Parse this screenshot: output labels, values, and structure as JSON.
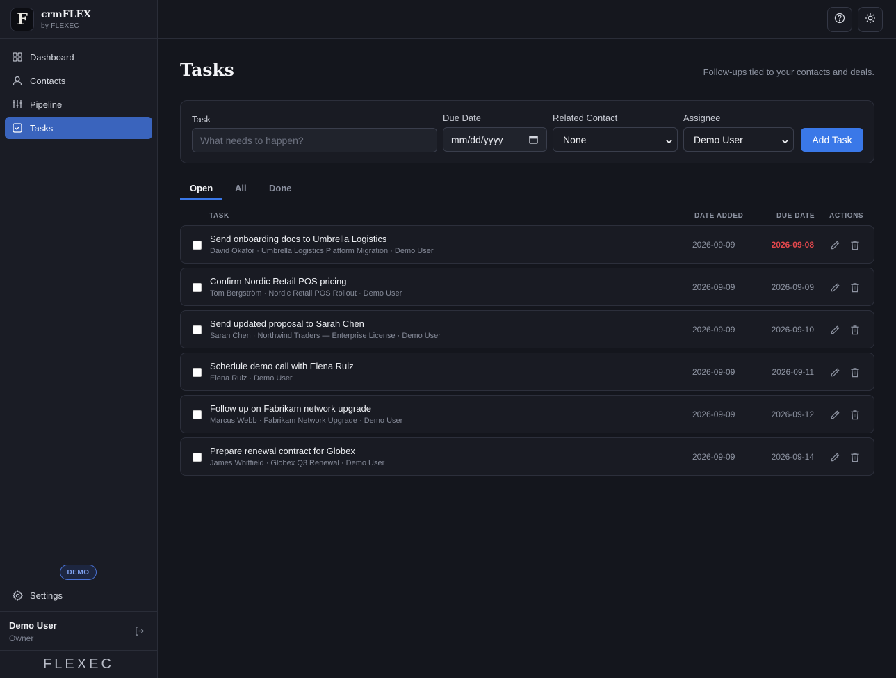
{
  "brand": {
    "logo_glyph": "F",
    "name": "crmFLEX",
    "sub": "by FLEXEC"
  },
  "nav": [
    {
      "label": "Dashboard",
      "icon": "grid-icon"
    },
    {
      "label": "Contacts",
      "icon": "user-icon"
    },
    {
      "label": "Pipeline",
      "icon": "sliders-icon"
    },
    {
      "label": "Tasks",
      "icon": "check-square-icon",
      "active": true
    }
  ],
  "sidebar_footer": {
    "badge": "DEMO",
    "settings_label": "Settings",
    "user_name": "Demo User",
    "user_role": "Owner",
    "footer_logo": "FLEXEC"
  },
  "page": {
    "title": "Tasks",
    "subtitle": "Follow-ups tied to your contacts and deals."
  },
  "form": {
    "task_label": "Task",
    "task_placeholder": "What needs to happen?",
    "due_label": "Due Date",
    "due_placeholder": "mm/dd/yyyy",
    "contact_label": "Related Contact",
    "contact_value": "None",
    "assignee_label": "Assignee",
    "assignee_value": "Demo User",
    "add_button": "Add Task"
  },
  "tabs": [
    "Open",
    "All",
    "Done"
  ],
  "table": {
    "headers": {
      "task": "TASK",
      "date_added": "DATE ADDED",
      "due_date": "DUE DATE",
      "actions": "ACTIONS"
    },
    "rows": [
      {
        "title": "Send onboarding docs to Umbrella Logistics",
        "meta": "David Okafor · Umbrella Logistics Platform Migration · Demo User",
        "added": "2026-09-09",
        "due": "2026-09-08",
        "overdue": true
      },
      {
        "title": "Confirm Nordic Retail POS pricing",
        "meta": "Tom Bergström · Nordic Retail POS Rollout · Demo User",
        "added": "2026-09-09",
        "due": "2026-09-09",
        "overdue": false
      },
      {
        "title": "Send updated proposal to Sarah Chen",
        "meta": "Sarah Chen · Northwind Traders — Enterprise License · Demo User",
        "added": "2026-09-09",
        "due": "2026-09-10",
        "overdue": false
      },
      {
        "title": "Schedule demo call with Elena Ruiz",
        "meta": "Elena Ruiz · Demo User",
        "added": "2026-09-09",
        "due": "2026-09-11",
        "overdue": false
      },
      {
        "title": "Follow up on Fabrikam network upgrade",
        "meta": "Marcus Webb · Fabrikam Network Upgrade · Demo User",
        "added": "2026-09-09",
        "due": "2026-09-12",
        "overdue": false
      },
      {
        "title": "Prepare renewal contract for Globex",
        "meta": "James Whitfield · Globex Q3 Renewal · Demo User",
        "added": "2026-09-09",
        "due": "2026-09-14",
        "overdue": false
      }
    ]
  },
  "colors": {
    "accent": "#3a78e8",
    "overdue": "#e5484d",
    "background": "#14161d"
  }
}
